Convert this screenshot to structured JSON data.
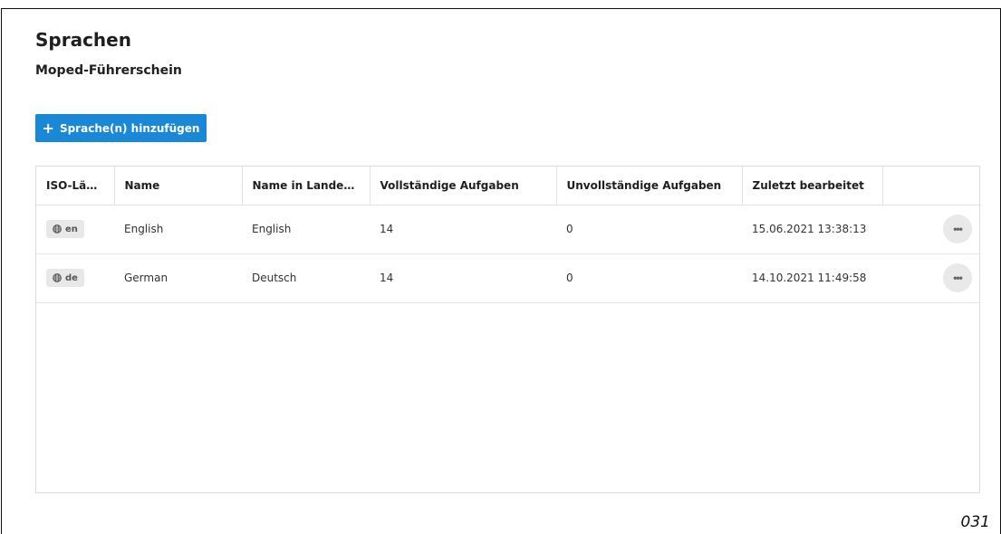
{
  "page": {
    "title": "Sprachen",
    "subtitle": "Moped-Führerschein",
    "add_button": {
      "label": "Sprache(n) hinzufügen",
      "icon": "plus-icon"
    },
    "accent_color": "#1a88d6",
    "page_number": "031"
  },
  "table": {
    "columns": [
      "ISO-Länd...",
      "Name",
      "Name in Landess...",
      "Vollständige Aufgaben",
      "Unvollständige Aufgaben",
      "Zuletzt bearbeitet",
      ""
    ],
    "rows": [
      {
        "iso": "en",
        "name": "English",
        "native_name": "English",
        "complete": "14",
        "incomplete": "0",
        "last_edited": "15.06.2021 13:38:13",
        "more": "•••"
      },
      {
        "iso": "de",
        "name": "German",
        "native_name": "Deutsch",
        "complete": "14",
        "incomplete": "0",
        "last_edited": "14.10.2021 11:49:58",
        "more": "•••"
      }
    ]
  }
}
